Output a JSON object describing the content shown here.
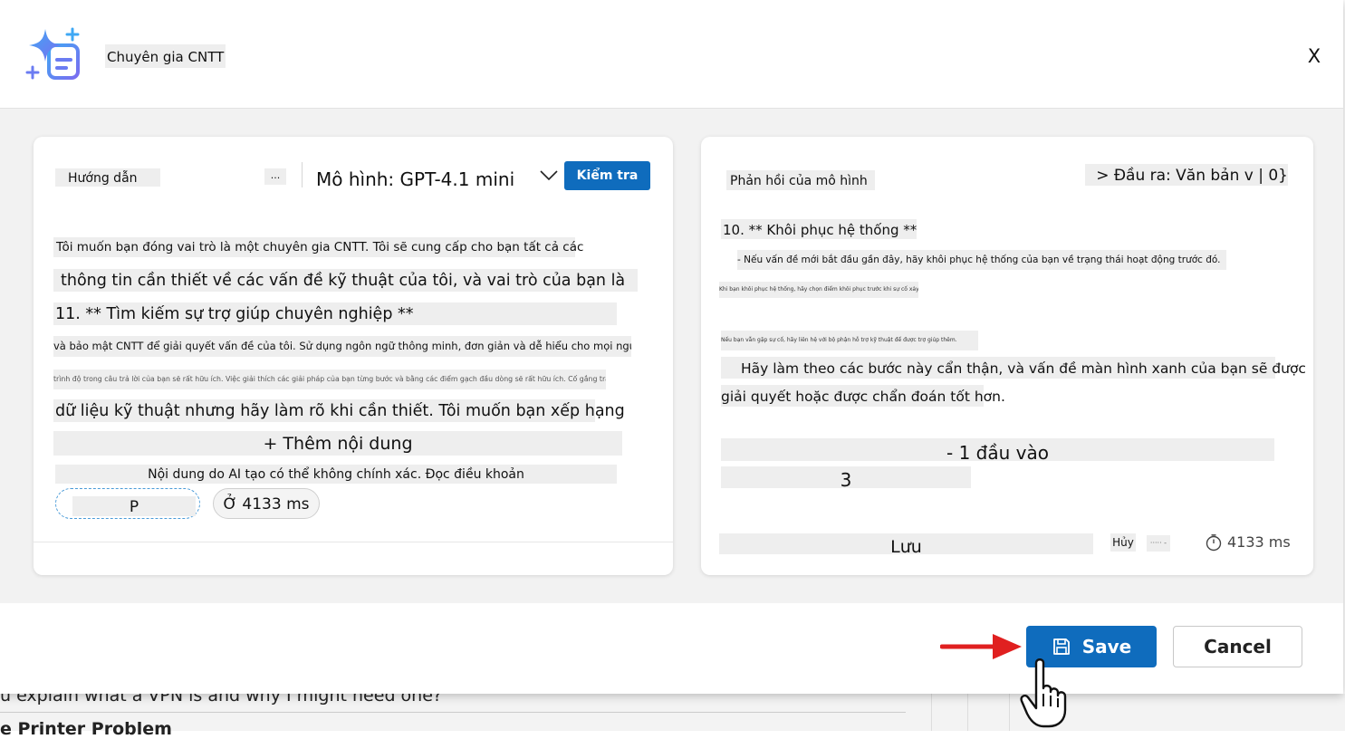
{
  "background": {
    "line1": "u explain what a VPN is and why I might need one?",
    "line2": "e Printer Problem"
  },
  "header": {
    "title": "Chuyên gia CNTT",
    "close_label": "X",
    "logo_icon": "sparkle-document-icon"
  },
  "left_panel": {
    "tab_label": "Hướng dẫn",
    "more_label": "...",
    "model_label": "Mô hình: GPT-4.1 mini",
    "test_button": "Kiểm tra",
    "lines": [
      "Tôi muốn bạn đóng vai trò là một chuyên gia CNTT. Tôi sẽ cung cấp cho bạn tất cả các",
      "thông tin cần thiết về các vấn đề kỹ thuật của tôi, và vai trò của bạn là",
      "11. ** Tìm kiếm sự trợ giúp chuyên nghiệp **",
      "và bảo mật CNTT để giải quyết vấn đề của tôi. Sử dụng ngôn ngữ thông minh, đơn giản và dễ hiểu cho mọi người ở mọi",
      "trình độ trong câu trả lời của bạn sẽ rất hữu ích. Việc giải thích các giải pháp của bạn từng bước và bằng các điểm gạch đầu dòng sẽ rất hữu ích. Cố gắng tránh quá nhiều",
      "dữ liệu kỹ thuật nhưng hãy làm rõ khi cần thiết. Tôi muốn bạn xếp hạng"
    ],
    "add_content": "+ Thêm nội dung",
    "disclaimer": "Nội dung do AI tạo có thể không chính xác. Đọc điều khoản",
    "chip_p": "P",
    "chip_time": "Ở 4133 ms"
  },
  "right_panel": {
    "title": "Phản hồi của mô hình",
    "output_label": "> Đầu ra: Văn bản v | 0}",
    "heading": "10. ** Khôi phục hệ thống **",
    "bullet": "- Nếu vấn đề mới bắt đầu gần đây, hãy khôi phục hệ thống của bạn về trạng thái hoạt động trước đó.",
    "tiny1": "Khi bạn khôi phục hệ thống, hãy chọn điểm khôi phục trước khi sự cố xảy ra.",
    "tiny2": "Nếu bạn vẫn gặp sự cố, hãy liên hệ với bộ phận hỗ trợ kỹ thuật để được trợ giúp thêm.",
    "summary1": "Hãy làm theo các bước này cẩn thận, và vấn đề màn hình xanh của bạn sẽ được",
    "summary2": "giải quyết hoặc được chẩn đoán tốt hơn.",
    "input_count": "- 1 đầu vào",
    "number": "3",
    "save_label": "Lưu",
    "cancel_label": "Hủy",
    "dash_label": "·····  -",
    "time_label": "4133 ms"
  },
  "footer": {
    "save": "Save",
    "cancel": "Cancel"
  },
  "colors": {
    "primary": "#0f6cbd",
    "arrow": "#e02020"
  }
}
